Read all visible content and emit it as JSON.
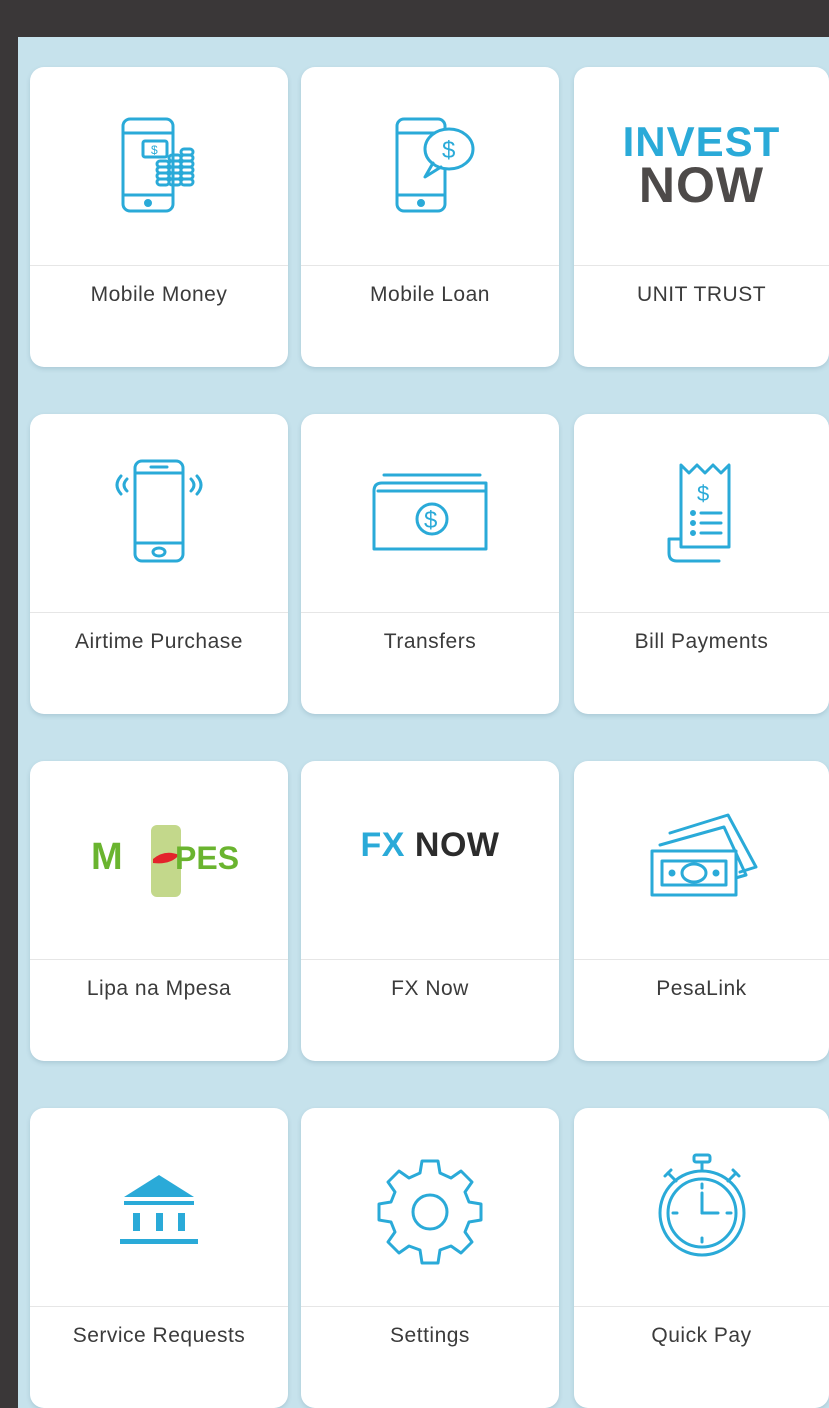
{
  "colors": {
    "accent": "#2aaad8",
    "panel_bg": "#c6e2ec",
    "frame": "#3a3738",
    "mpesa_green": "#6ab42f",
    "mpesa_red": "#e3242b"
  },
  "tiles": [
    {
      "label": "Mobile Money",
      "icon": "phone-coins-icon"
    },
    {
      "label": "Mobile Loan",
      "icon": "phone-dollar-bubble-icon"
    },
    {
      "label": "UNIT TRUST",
      "icon": "invest-now-logo",
      "logo_line1": "INVEST",
      "logo_line2": "NOW"
    },
    {
      "label": "Airtime Purchase",
      "icon": "phone-ringing-icon"
    },
    {
      "label": "Transfers",
      "icon": "wallet-dollar-icon"
    },
    {
      "label": "Bill Payments",
      "icon": "receipt-icon"
    },
    {
      "label": "Lipa na Mpesa",
      "icon": "mpesa-logo",
      "logo_text": "M-PESA"
    },
    {
      "label": "FX Now",
      "icon": "fx-now-logo",
      "logo_fx": "FX",
      "logo_now": "NOW"
    },
    {
      "label": "PesaLink",
      "icon": "banknotes-icon"
    },
    {
      "label": "Service Requests",
      "icon": "bank-building-icon"
    },
    {
      "label": "Settings",
      "icon": "gear-icon"
    },
    {
      "label": "Quick Pay",
      "icon": "stopwatch-icon"
    }
  ]
}
